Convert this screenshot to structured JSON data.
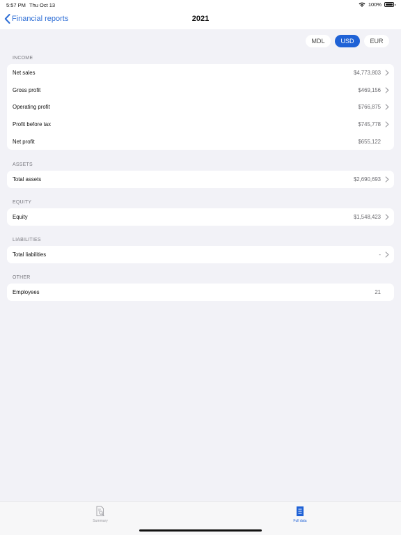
{
  "status_bar": {
    "time": "5:57 PM",
    "date": "Thu Oct 13",
    "battery": "100%"
  },
  "nav": {
    "back_label": "Financial reports",
    "title": "2021"
  },
  "currency": {
    "options": [
      "MDL",
      "USD",
      "EUR"
    ],
    "selected": "USD"
  },
  "sections": {
    "income": {
      "header": "INCOME",
      "rows": [
        {
          "label": "Net sales",
          "value": "$4,773,803"
        },
        {
          "label": "Gross profit",
          "value": "$469,156"
        },
        {
          "label": "Operating profit",
          "value": "$766,875"
        },
        {
          "label": "Profit before tax",
          "value": "$745,778"
        },
        {
          "label": "Net profit",
          "value": "$655,122"
        }
      ]
    },
    "assets": {
      "header": "ASSETS",
      "rows": [
        {
          "label": "Total assets",
          "value": "$2,690,693"
        }
      ]
    },
    "equity": {
      "header": "EQUITY",
      "rows": [
        {
          "label": "Equity",
          "value": "$1,548,423"
        }
      ]
    },
    "liabilities": {
      "header": "LIABILITIES",
      "rows": [
        {
          "label": "Total liabilities",
          "value": "-"
        }
      ]
    },
    "other": {
      "header": "OTHER",
      "rows": [
        {
          "label": "Employees",
          "value": "21"
        }
      ]
    }
  },
  "tab_bar": {
    "summary_label": "Summary",
    "full_label": "Full data",
    "selected": "Full data",
    "accent_color": "#1f62d6"
  }
}
